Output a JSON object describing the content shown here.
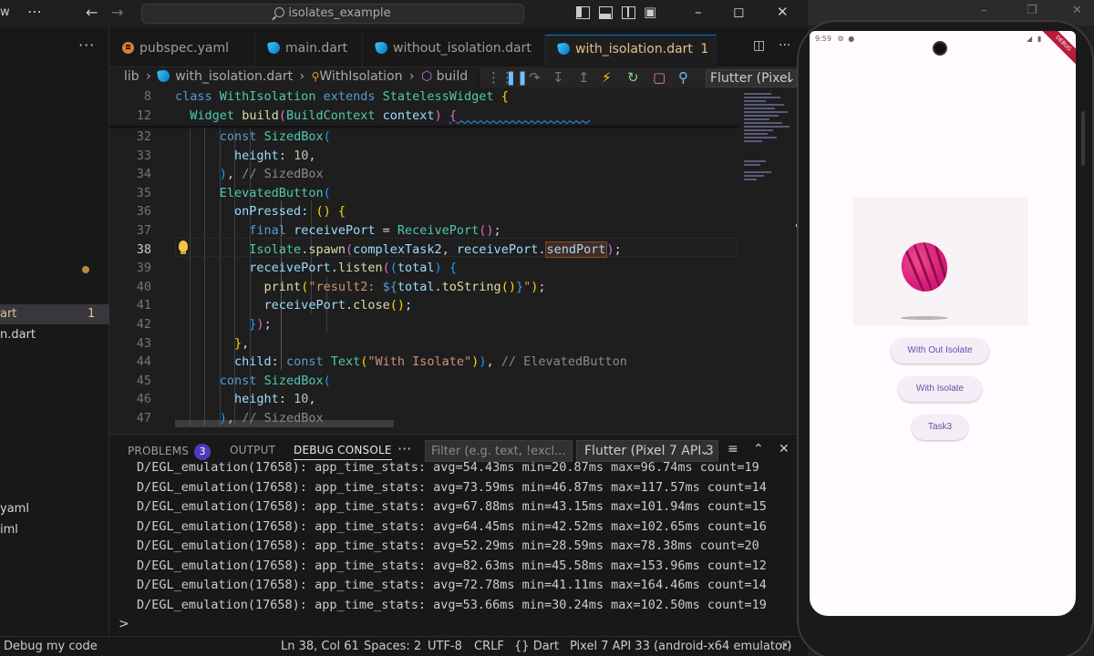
{
  "titlebar": {
    "menu_fragment": "w",
    "search_text": "isolates_example"
  },
  "sidebar": {
    "rows": [
      {
        "label": "art",
        "count": "1"
      },
      {
        "label": "n.dart"
      },
      {
        "label": "yaml"
      },
      {
        "label": "iml"
      }
    ]
  },
  "tabs": [
    {
      "label": "pubspec.yaml"
    },
    {
      "label": "main.dart"
    },
    {
      "label": "without_isolation.dart"
    },
    {
      "label": "with_isolation.dart",
      "badge": "1"
    }
  ],
  "breadcrumb": {
    "root": "lib",
    "file": "with_isolation.dart",
    "class": "WithIsolation",
    "method": "build"
  },
  "debug_toolbar": {
    "device": "Flutter (Pixel"
  },
  "editor": {
    "sticky_numbers": [
      "8",
      "12"
    ],
    "line_numbers": [
      "32",
      "33",
      "34",
      "35",
      "36",
      "37",
      "38",
      "39",
      "40",
      "41",
      "42",
      "43",
      "44",
      "45",
      "46",
      "47"
    ],
    "current_line": "38"
  },
  "panel": {
    "tabs": {
      "problems": "PROBLEMS",
      "problems_count": "3",
      "output": "OUTPUT",
      "debug_console": "DEBUG CONSOLE"
    },
    "filter_placeholder": "Filter (e.g. text, !excl...",
    "session": "Flutter (Pixel 7 API 3",
    "logs": [
      "D/EGL_emulation(17658): app_time_stats: avg=54.43ms min=20.87ms max=96.74ms count=19",
      "D/EGL_emulation(17658): app_time_stats: avg=73.59ms min=46.87ms max=117.57ms count=14",
      "D/EGL_emulation(17658): app_time_stats: avg=67.88ms min=43.15ms max=101.94ms count=15",
      "D/EGL_emulation(17658): app_time_stats: avg=64.45ms min=42.52ms max=102.65ms count=16",
      "D/EGL_emulation(17658): app_time_stats: avg=52.29ms min=28.59ms max=78.38ms count=20",
      "D/EGL_emulation(17658): app_time_stats: avg=82.63ms min=45.58ms max=153.96ms count=12",
      "D/EGL_emulation(17658): app_time_stats: avg=72.78ms min=41.11ms max=164.46ms count=14",
      "D/EGL_emulation(17658): app_time_stats: avg=53.66ms min=30.24ms max=102.50ms count=19"
    ],
    "prompt": ">"
  },
  "statusbar": {
    "debug": "Debug my code",
    "position": "Ln 38, Col 61",
    "spaces": "Spaces: 2",
    "encoding": "UTF-8",
    "eol": "CRLF",
    "language": "Dart",
    "device": "Pixel 7 API 33 (android-x64 emulator)"
  },
  "emulator": {
    "clock": "9:59",
    "ribbon": "DEBUG",
    "buttons": [
      "With Out Isolate",
      "With Isolate",
      "Task3"
    ]
  },
  "colors": {
    "accent": "#0078d4",
    "modified_tab": "#e2c08d",
    "badge": "#4d3bbd",
    "ball": "#d81b78",
    "button_text": "#6750a4"
  }
}
